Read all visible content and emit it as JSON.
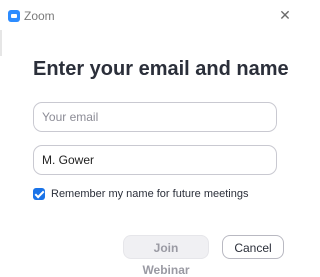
{
  "window": {
    "title": "Zoom",
    "close_symbol": "✕",
    "app_icon": "zoom-logo-icon",
    "accent_color": "#2d8cff"
  },
  "form": {
    "heading": "Enter your email and name",
    "email": {
      "placeholder": "Your email",
      "value": ""
    },
    "name": {
      "placeholder": "",
      "value": "M. Gower"
    },
    "remember": {
      "label": "Remember my name for future meetings",
      "checked": true,
      "color": "#1a73e8"
    }
  },
  "buttons": {
    "join_label": "Join Webinar",
    "join_enabled": false,
    "cancel_label": "Cancel"
  }
}
